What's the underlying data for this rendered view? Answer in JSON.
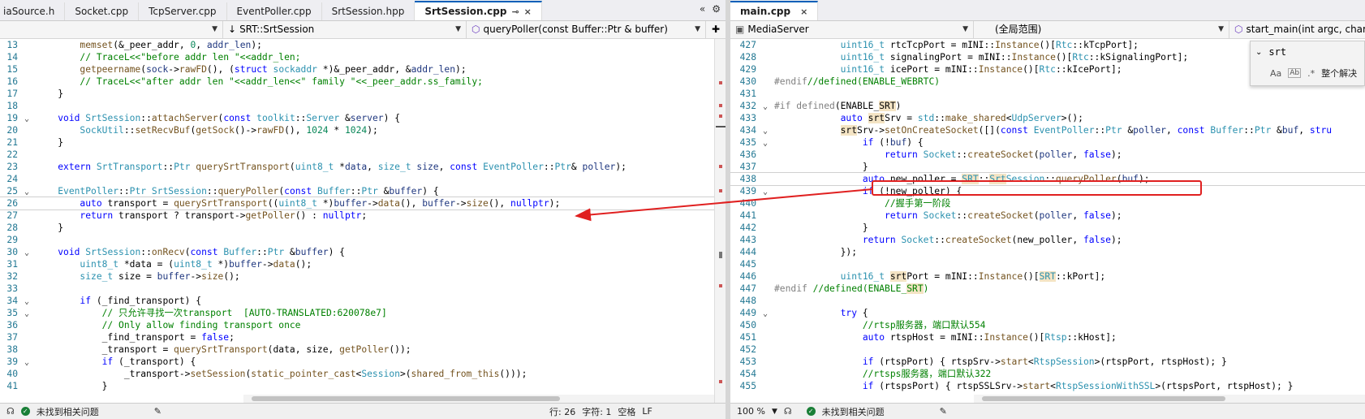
{
  "left_tabs": [
    {
      "label": "iaSource.h",
      "active": false
    },
    {
      "label": "Socket.cpp",
      "active": false
    },
    {
      "label": "TcpServer.cpp",
      "active": false
    },
    {
      "label": "EventPoller.cpp",
      "active": false
    },
    {
      "label": "SrtSession.hpp",
      "active": false
    },
    {
      "label": "SrtSession.cpp",
      "active": true
    }
  ],
  "right_tabs": [
    {
      "label": "main.cpp",
      "active": true
    }
  ],
  "tab_pin": "⊸",
  "tab_close": "×",
  "tab_buttons": [
    "«",
    "⚙"
  ],
  "left_nav": {
    "scope": "",
    "class": "SRT::SrtSession",
    "method": "queryPoller(const Buffer::Ptr & buffer)"
  },
  "right_nav": {
    "project": "MediaServer",
    "scope": "(全局范围)",
    "method": "start_main(int argc, char *"
  },
  "find": {
    "value": "srt",
    "opt_aa": "Aa",
    "opt_ab": "Ab",
    "opt_re": ".*",
    "replace_all": "整个解决"
  },
  "left_code": [
    {
      "n": "13",
      "fold": "",
      "html": "        <span class=\"f\">memset</span>(&amp;<span class=\"n\">_peer_addr</span>, <span class=\"m\">0</span>, <span class=\"p\">addr_len</span>);"
    },
    {
      "n": "14",
      "fold": "",
      "html": "        <span class=\"c\">// TraceL&lt;&lt;\"before addr len \"&lt;&lt;addr_len;</span>"
    },
    {
      "n": "15",
      "fold": "",
      "html": "        <span class=\"f\">getpeername</span>(<span class=\"p\">sock</span>-&gt;<span class=\"f\">rawFD</span>(), (<span class=\"k\">struct</span> <span class=\"t\">sockaddr</span> *)&amp;<span class=\"n\">_peer_addr</span>, &amp;<span class=\"p\">addr_len</span>);"
    },
    {
      "n": "16",
      "fold": "",
      "html": "        <span class=\"c\">// TraceL&lt;&lt;\"after addr len \"&lt;&lt;addr_len&lt;&lt;\" family \"&lt;&lt;_peer_addr.ss_family;</span>"
    },
    {
      "n": "17",
      "fold": "",
      "html": "    }"
    },
    {
      "n": "18",
      "fold": "",
      "html": ""
    },
    {
      "n": "19",
      "fold": "⌄",
      "html": "    <span class=\"k\">void</span> <span class=\"t\">SrtSession</span>::<span class=\"f\">attachServer</span>(<span class=\"k\">const</span> <span class=\"t\">toolkit</span>::<span class=\"t\">Server</span> &amp;<span class=\"p\">server</span>) {"
    },
    {
      "n": "20",
      "fold": "",
      "html": "        <span class=\"t\">SockUtil</span>::<span class=\"f\">setRecvBuf</span>(<span class=\"f\">getSock</span>()-&gt;<span class=\"f\">rawFD</span>(), <span class=\"m\">1024</span> * <span class=\"m\">1024</span>);"
    },
    {
      "n": "21",
      "fold": "",
      "html": "    }"
    },
    {
      "n": "22",
      "fold": "",
      "html": ""
    },
    {
      "n": "23",
      "fold": "",
      "html": "    <span class=\"k\">extern</span> <span class=\"t\">SrtTransport</span>::<span class=\"t\">Ptr</span> <span class=\"f\">querySrtTransport</span>(<span class=\"t\">uint8_t</span> *<span class=\"p\">data</span>, <span class=\"t\">size_t</span> <span class=\"p\">size</span>, <span class=\"k\">const</span> <span class=\"t\">EventPoller</span>::<span class=\"t\">Ptr</span>&amp; <span class=\"p\">poller</span>);"
    },
    {
      "n": "24",
      "fold": "",
      "html": ""
    },
    {
      "n": "25",
      "fold": "⌄",
      "html": "    <span class=\"t\">EventPoller</span>::<span class=\"t\">Ptr</span> <span class=\"t\">SrtSession</span>::<span class=\"f\">queryPoller</span>(<span class=\"k\">const</span> <span class=\"t\">Buffer</span>::<span class=\"t\">Ptr</span> &amp;<span class=\"p\">buffer</span>) {"
    },
    {
      "n": "26",
      "fold": "",
      "cur": true,
      "html": "        <span class=\"k\">auto</span> <span class=\"n\">transport</span> = <span class=\"f\">querySrtTransport</span>((<span class=\"t\">uint8_t</span> *)<span class=\"p\">buffer</span>-&gt;<span class=\"f\">data</span>(), <span class=\"p\">buffer</span>-&gt;<span class=\"f\">size</span>(), <span class=\"k\">nullptr</span>);"
    },
    {
      "n": "27",
      "fold": "",
      "html": "        <span class=\"k\">return</span> <span class=\"n\">transport</span> ? <span class=\"n\">transport</span>-&gt;<span class=\"f\">getPoller</span>() : <span class=\"k\">nullptr</span>;"
    },
    {
      "n": "28",
      "fold": "",
      "html": "    }"
    },
    {
      "n": "29",
      "fold": "",
      "html": ""
    },
    {
      "n": "30",
      "fold": "⌄",
      "html": "    <span class=\"k\">void</span> <span class=\"t\">SrtSession</span>::<span class=\"f\">onRecv</span>(<span class=\"k\">const</span> <span class=\"t\">Buffer</span>::<span class=\"t\">Ptr</span> &amp;<span class=\"p\">buffer</span>) {"
    },
    {
      "n": "31",
      "fold": "",
      "html": "        <span class=\"t\">uint8_t</span> *<span class=\"n\">data</span> = (<span class=\"t\">uint8_t</span> *)<span class=\"p\">buffer</span>-&gt;<span class=\"f\">data</span>();"
    },
    {
      "n": "32",
      "fold": "",
      "html": "        <span class=\"t\">size_t</span> <span class=\"n\">size</span> = <span class=\"p\">buffer</span>-&gt;<span class=\"f\">size</span>();"
    },
    {
      "n": "33",
      "fold": "",
      "html": ""
    },
    {
      "n": "34",
      "fold": "⌄",
      "html": "        <span class=\"k\">if</span> (<span class=\"n\">_find_transport</span>) {"
    },
    {
      "n": "35",
      "fold": "⌄",
      "html": "            <span class=\"c\">// 只允许寻找一次transport  [AUTO-TRANSLATED:620078e7]</span>"
    },
    {
      "n": "36",
      "fold": "",
      "html": "            <span class=\"c\">// Only allow finding transport once</span>"
    },
    {
      "n": "37",
      "fold": "",
      "html": "            <span class=\"n\">_find_transport</span> = <span class=\"k\">false</span>;"
    },
    {
      "n": "38",
      "fold": "",
      "html": "            <span class=\"n\">_transport</span> = <span class=\"f\">querySrtTransport</span>(<span class=\"n\">data</span>, <span class=\"n\">size</span>, <span class=\"f\">getPoller</span>());"
    },
    {
      "n": "39",
      "fold": "⌄",
      "html": "            <span class=\"k\">if</span> (<span class=\"n\">_transport</span>) {"
    },
    {
      "n": "40",
      "fold": "",
      "html": "                <span class=\"n\">_transport</span>-&gt;<span class=\"f\">setSession</span>(<span class=\"f\">static_pointer_cast</span>&lt;<span class=\"t\">Session</span>&gt;(<span class=\"f\">shared_from_this</span>()));"
    },
    {
      "n": "41",
      "fold": "",
      "html": "            }"
    }
  ],
  "right_code": [
    {
      "n": "427",
      "fold": "",
      "html": "            <span class=\"t\">uint16_t</span> <span class=\"n\">rtcTcpPort</span> = <span class=\"n\">mINI</span>::<span class=\"f\">Instance</span>()[<span class=\"t\">Rtc</span>::<span class=\"n\">kTcpPort</span>];"
    },
    {
      "n": "428",
      "fold": "",
      "html": "            <span class=\"t\">uint16_t</span> <span class=\"n\">signalingPort</span> = <span class=\"n\">mINI</span>::<span class=\"f\">Instance</span>()[<span class=\"t\">Rtc</span>::<span class=\"n\">kSignalingPort</span>];"
    },
    {
      "n": "429",
      "fold": "",
      "html": "            <span class=\"t\">uint16_t</span> <span class=\"n\">icePort</span> = <span class=\"n\">mINI</span>::<span class=\"f\">Instance</span>()[<span class=\"t\">Rtc</span>::<span class=\"n\">kIcePort</span>];"
    },
    {
      "n": "430",
      "fold": "",
      "html": "<span class=\"pp\">#endif</span><span class=\"c\">//defined(ENABLE_WEBRTC)</span>"
    },
    {
      "n": "431",
      "fold": "",
      "html": ""
    },
    {
      "n": "432",
      "fold": "⌄",
      "html": "<span class=\"pp\">#if</span> <span class=\"pp\">defined</span>(<span class=\"n\">ENABLE_<span class=\"hl\">SRT</span></span>)"
    },
    {
      "n": "433",
      "fold": "",
      "html": "            <span class=\"k\">auto</span> <span class=\"n\"><span class=\"hl\">srt</span>Srv</span> = <span class=\"t\">std</span>::<span class=\"f\">make_shared</span>&lt;<span class=\"t\">UdpServer</span>&gt;();"
    },
    {
      "n": "434",
      "fold": "⌄",
      "html": "            <span class=\"n\"><span class=\"hl\">srt</span>Srv</span>-&gt;<span class=\"f\">setOnCreateSocket</span>([](<span class=\"k\">const</span> <span class=\"t\">EventPoller</span>::<span class=\"t\">Ptr</span> &amp;<span class=\"p\">poller</span>, <span class=\"k\">const</span> <span class=\"t\">Buffer</span>::<span class=\"t\">Ptr</span> &amp;<span class=\"p\">buf</span>, <span class=\"k\">stru</span>"
    },
    {
      "n": "435",
      "fold": "⌄",
      "html": "                <span class=\"k\">if</span> (!<span class=\"p\">buf</span>) {"
    },
    {
      "n": "436",
      "fold": "",
      "html": "                    <span class=\"k\">return</span> <span class=\"t\">Socket</span>::<span class=\"f\">createSocket</span>(<span class=\"p\">poller</span>, <span class=\"k\">false</span>);"
    },
    {
      "n": "437",
      "fold": "",
      "html": "                }"
    },
    {
      "n": "438",
      "fold": "",
      "cur": true,
      "html": "                <span class=\"k\">auto</span> <span class=\"n\">new_poller</span> = <span class=\"t\"><span class=\"hl\">SRT</span></span>::<span class=\"t\"><span class=\"hl\">Srt</span>Session</span>::<span class=\"f\">queryPoller</span>(<span class=\"p\">buf</span>);"
    },
    {
      "n": "439",
      "fold": "⌄",
      "html": "                <span class=\"k\">if</span> (!<span class=\"n\">new_poller</span>) {"
    },
    {
      "n": "440",
      "fold": "",
      "html": "                    <span class=\"c\">//握手第一阶段</span>"
    },
    {
      "n": "441",
      "fold": "",
      "html": "                    <span class=\"k\">return</span> <span class=\"t\">Socket</span>::<span class=\"f\">createSocket</span>(<span class=\"p\">poller</span>, <span class=\"k\">false</span>);"
    },
    {
      "n": "442",
      "fold": "",
      "html": "                }"
    },
    {
      "n": "443",
      "fold": "",
      "html": "                <span class=\"k\">return</span> <span class=\"t\">Socket</span>::<span class=\"f\">createSocket</span>(<span class=\"n\">new_poller</span>, <span class=\"k\">false</span>);"
    },
    {
      "n": "444",
      "fold": "",
      "html": "            });"
    },
    {
      "n": "445",
      "fold": "",
      "html": ""
    },
    {
      "n": "446",
      "fold": "",
      "html": "            <span class=\"t\">uint16_t</span> <span class=\"n\"><span class=\"hl\">srt</span>Port</span> = <span class=\"n\">mINI</span>::<span class=\"f\">Instance</span>()[<span class=\"t\"><span class=\"hl\">SRT</span></span>::<span class=\"n\">kPort</span>];"
    },
    {
      "n": "447",
      "fold": "",
      "html": "<span class=\"pp\">#endif</span> <span class=\"c\">//defined(ENABLE_<span class=\"hl\">SRT</span>)</span>"
    },
    {
      "n": "448",
      "fold": "",
      "html": ""
    },
    {
      "n": "449",
      "fold": "⌄",
      "html": "            <span class=\"k\">try</span> {"
    },
    {
      "n": "450",
      "fold": "",
      "html": "                <span class=\"c\">//rtsp服务器，端口默认554</span>"
    },
    {
      "n": "451",
      "fold": "",
      "html": "                <span class=\"k\">auto</span> <span class=\"n\">rtspHost</span> = <span class=\"n\">mINI</span>::<span class=\"f\">Instance</span>()[<span class=\"t\">Rtsp</span>::<span class=\"n\">kHost</span>];"
    },
    {
      "n": "452",
      "fold": "",
      "html": ""
    },
    {
      "n": "453",
      "fold": "",
      "html": "                <span class=\"k\">if</span> (<span class=\"n\">rtspPort</span>) { <span class=\"n\">rtspSrv</span>-&gt;<span class=\"f\">start</span>&lt;<span class=\"t\">RtspSession</span>&gt;(<span class=\"n\">rtspPort</span>, <span class=\"n\">rtspHost</span>); }"
    },
    {
      "n": "454",
      "fold": "",
      "html": "                <span class=\"c\">//rtsps服务器，端口默认322</span>"
    },
    {
      "n": "455",
      "fold": "",
      "html": "                <span class=\"k\">if</span> (<span class=\"n\">rtspsPort</span>) { <span class=\"n\">rtspSSLSrv</span>-&gt;<span class=\"f\">start</span>&lt;<span class=\"t\">RtspSessionWithSSL</span>&gt;(<span class=\"n\">rtspsPort</span>, <span class=\"n\">rtspHost</span>); }"
    }
  ],
  "left_status": {
    "issues": "未找到相关问题",
    "pos": "行: 26",
    "char": "字符: 1",
    "ws": "空格",
    "eol": "LF"
  },
  "right_status": {
    "zoom": "100 %",
    "issues": "未找到相关问题"
  },
  "colors": {
    "accent": "#005fb8",
    "highlight_box": "#e02020"
  }
}
